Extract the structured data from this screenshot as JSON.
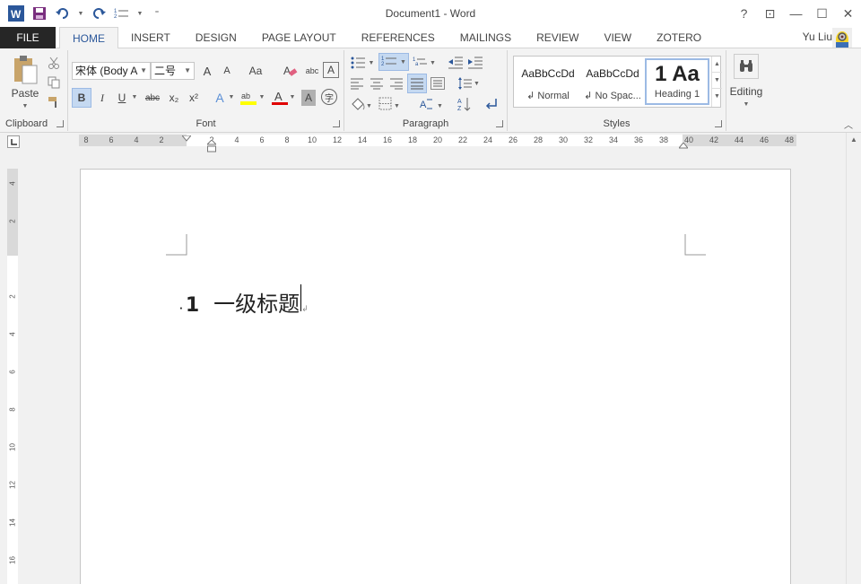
{
  "titlebar": {
    "title": "Document1 - Word",
    "help": "?",
    "ribbon_options": "⊡",
    "minimize": "—",
    "maximize": "☐",
    "close": "✕"
  },
  "tabs": {
    "file": "FILE",
    "items": [
      "HOME",
      "INSERT",
      "DESIGN",
      "PAGE LAYOUT",
      "REFERENCES",
      "MAILINGS",
      "REVIEW",
      "VIEW",
      "ZOTERO"
    ],
    "active": "HOME",
    "user": "Yu Liu"
  },
  "ribbon": {
    "clipboard": {
      "label": "Clipboard",
      "paste": "Paste"
    },
    "font": {
      "label": "Font",
      "font_name": "宋体 (Body A",
      "font_size": "二号",
      "bold": "B",
      "italic": "I",
      "underline": "U",
      "strike": "abc",
      "subscript": "x₂",
      "superscript": "x²",
      "grow": "A",
      "shrink": "A",
      "case": "Aa",
      "text_effect": "A",
      "font_color": "A",
      "shading": "A",
      "enclose": "字"
    },
    "paragraph": {
      "label": "Paragraph"
    },
    "styles": {
      "label": "Styles",
      "items": [
        {
          "sample": "AaBbCcDd",
          "name": "↲ Normal"
        },
        {
          "sample": "AaBbCcDd",
          "name": "↲ No Spac..."
        },
        {
          "sample": "1  Aa",
          "name": "Heading 1"
        }
      ]
    },
    "editing": {
      "label": "Editing"
    }
  },
  "ruler": {
    "ticks": [
      "8",
      "6",
      "4",
      "2",
      "",
      "2",
      "4",
      "6",
      "8",
      "10",
      "12",
      "14",
      "16",
      "18",
      "20",
      "22",
      "24",
      "26",
      "28",
      "30",
      "32",
      "34",
      "36",
      "38",
      "40",
      "42",
      "44",
      "46",
      "48"
    ],
    "vticks": [
      "4",
      "2",
      "",
      "2",
      "4",
      "6",
      "8",
      "10",
      "12",
      "14",
      "16"
    ]
  },
  "document": {
    "heading_number": "1",
    "heading_text": "一级标题",
    "paragraph_mark": "↲"
  }
}
